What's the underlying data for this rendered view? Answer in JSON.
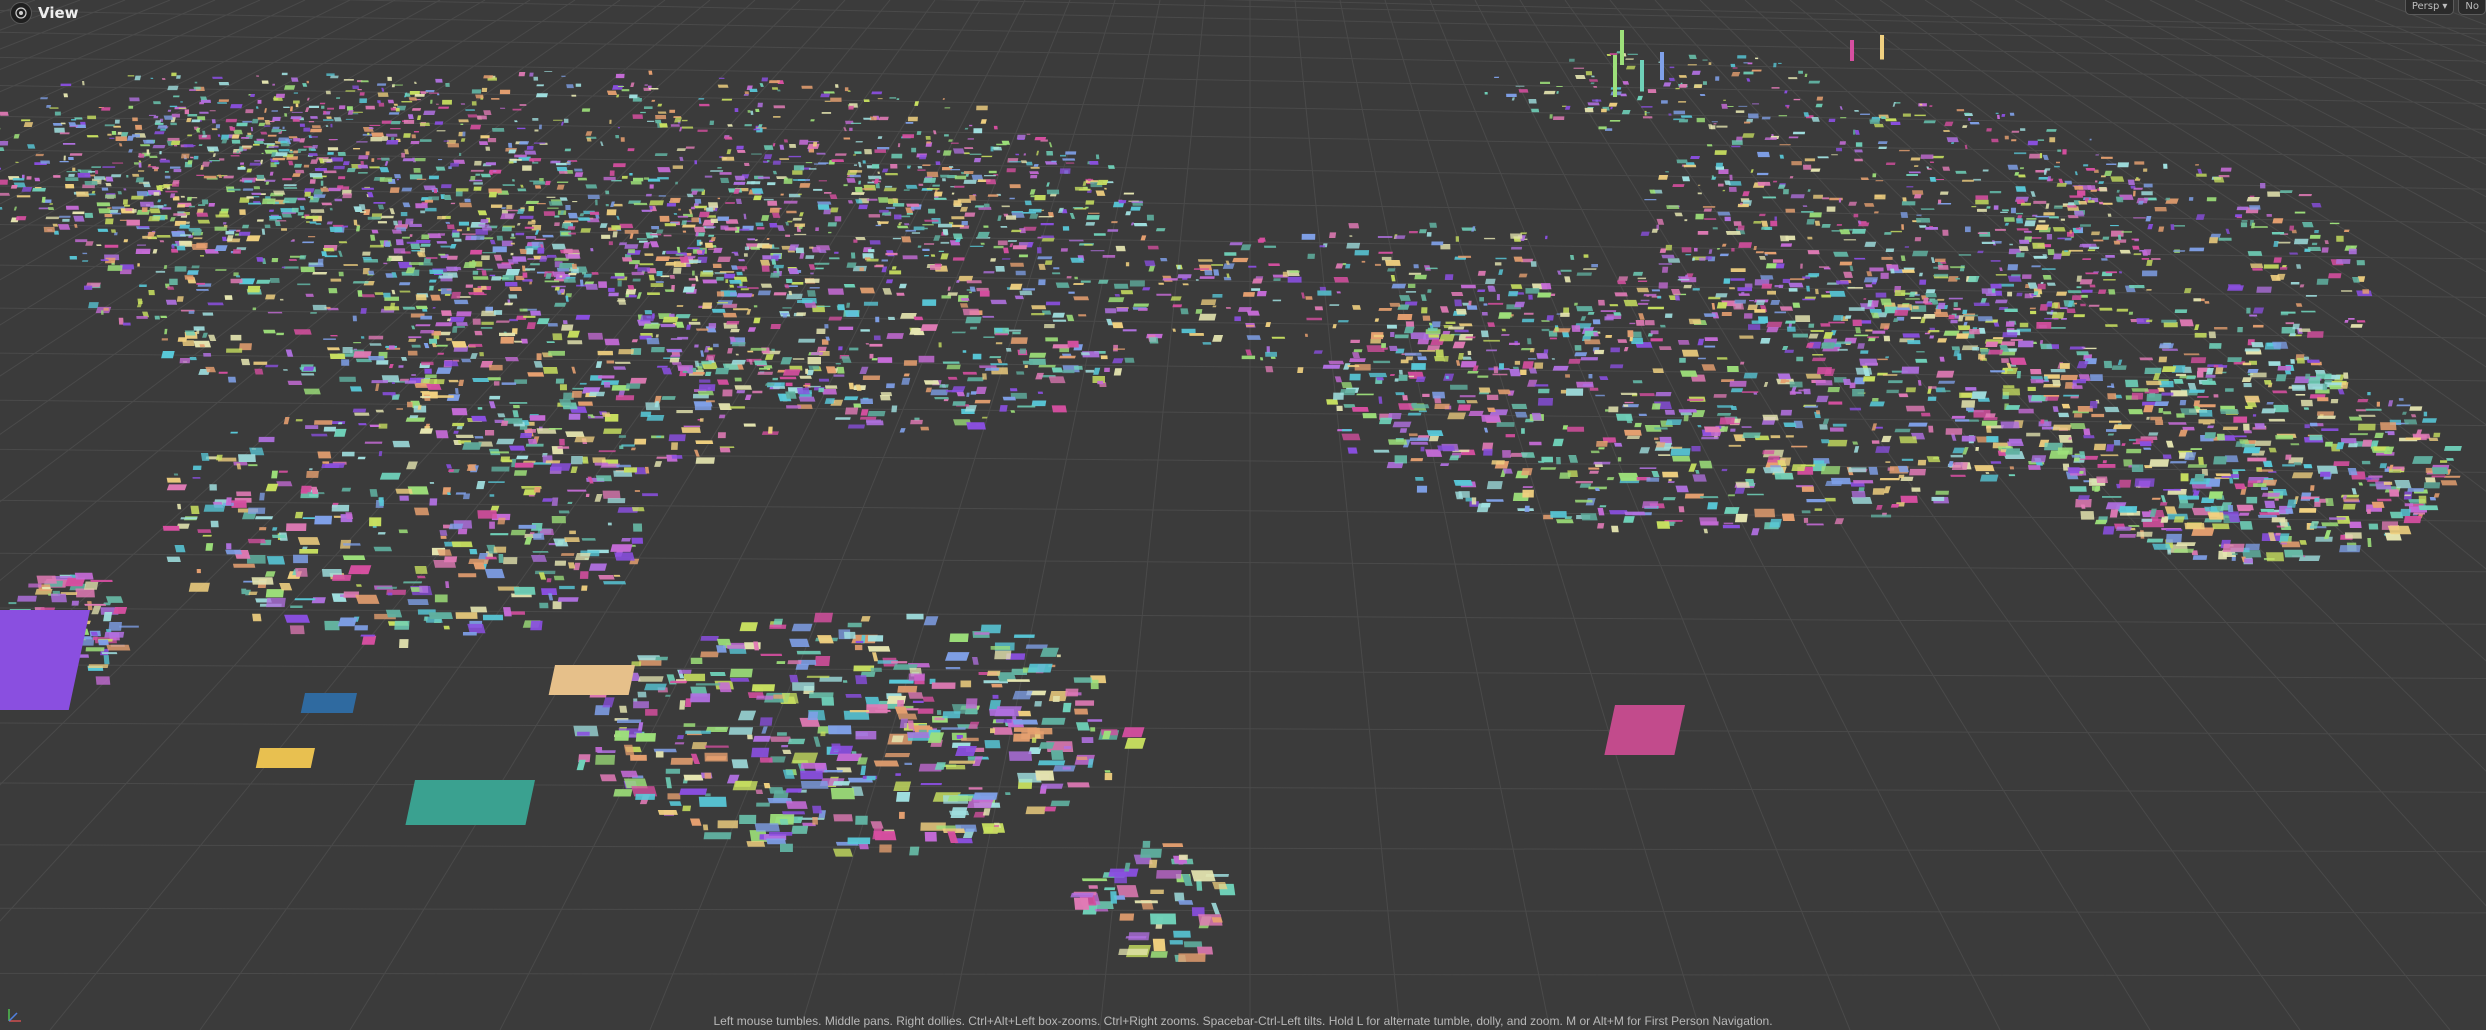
{
  "viewport": {
    "title": "View",
    "camera_label": "Persp",
    "display_label": "No",
    "status_hint": "Left mouse tumbles. Middle pans. Right dollies. Ctrl+Alt+Left box-zooms. Ctrl+Right zooms. Spacebar-Ctrl-Left tilts. Hold L for alternate tumble, dolly, and zoom. M or Alt+M for First Person Navigation."
  },
  "colors": {
    "background": "#3b3b3b",
    "grid": "#4a4a4a",
    "building_palette": [
      "#c56bd6",
      "#8a4fe0",
      "#6fd1b9",
      "#58c8d8",
      "#9de07a",
      "#e07ab5",
      "#f0d080",
      "#e6a070",
      "#7fa0e8",
      "#c8e060",
      "#d64fa0",
      "#a0e0e0",
      "#e5e5b0",
      "#b070e0",
      "#60b0a0"
    ]
  },
  "icons": {
    "view": "houdini-view-icon",
    "camera_menu": "chevron-down-icon",
    "axis": "axis-gizmo-icon"
  }
}
